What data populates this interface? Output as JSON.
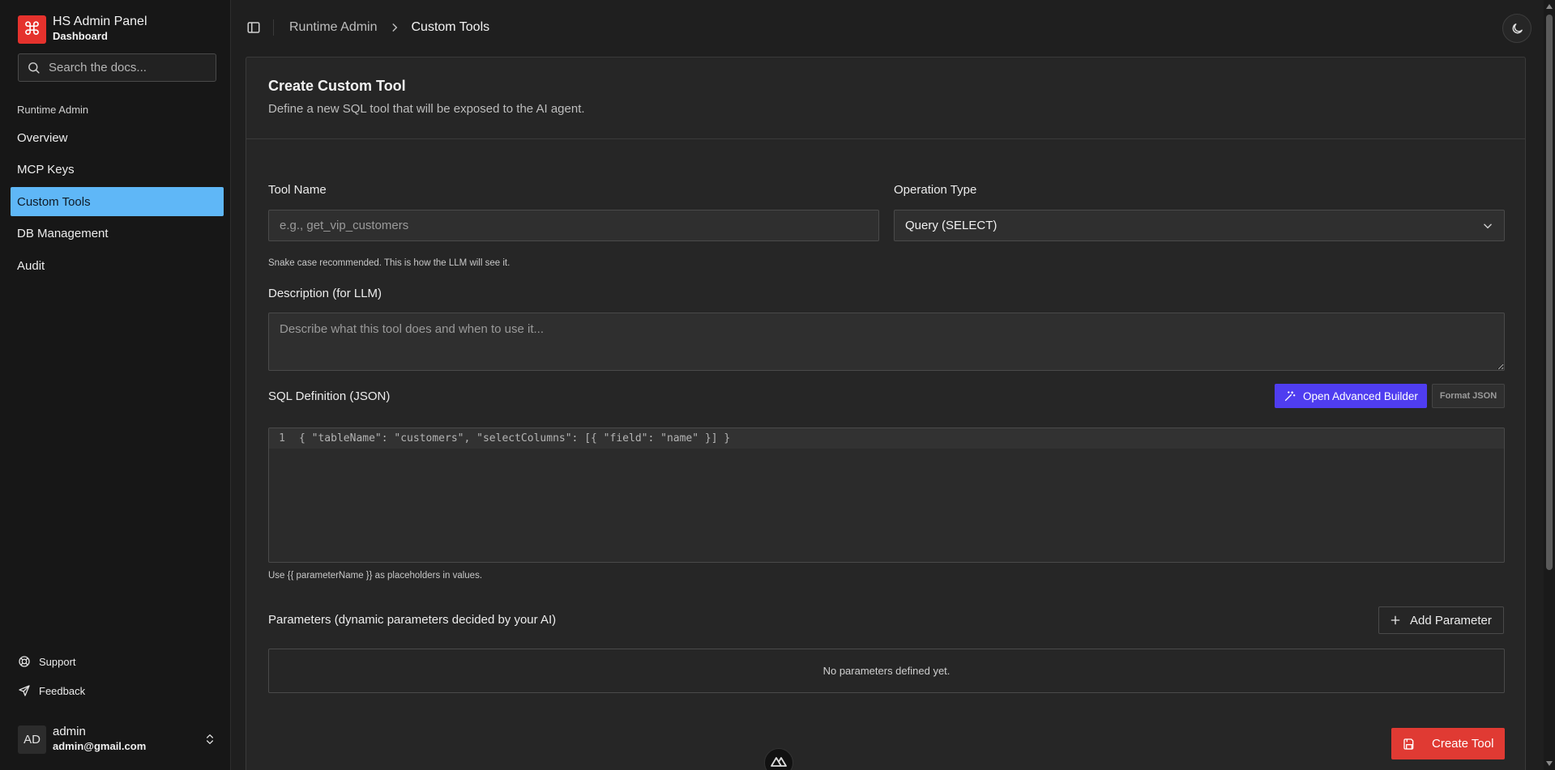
{
  "sidebar": {
    "brand": {
      "logo_glyph": "⌘",
      "title": "HS Admin Panel",
      "subtitle": "Dashboard",
      "logo_color": "#e5322d"
    },
    "search": {
      "placeholder": "Search the docs..."
    },
    "section_label": "Runtime Admin",
    "items": [
      {
        "label": "Overview",
        "active": false
      },
      {
        "label": "MCP Keys",
        "active": false
      },
      {
        "label": "Custom Tools",
        "active": true
      },
      {
        "label": "DB Management",
        "active": false
      },
      {
        "label": "Audit",
        "active": false
      }
    ],
    "footer": {
      "support": "Support",
      "feedback": "Feedback"
    },
    "user": {
      "initials": "AD",
      "name": "admin",
      "email": "admin@gmail.com"
    }
  },
  "header": {
    "breadcrumb": {
      "parent": "Runtime Admin",
      "current": "Custom Tools"
    }
  },
  "form": {
    "title": "Create Custom Tool",
    "description": "Define a new SQL tool that will be exposed to the AI agent.",
    "tool_name": {
      "label": "Tool Name",
      "placeholder": "e.g., get_vip_customers",
      "hint": "Snake case recommended. This is how the LLM will see it."
    },
    "operation_type": {
      "label": "Operation Type",
      "value": "Query (SELECT)"
    },
    "llm_description": {
      "label": "Description (for LLM)",
      "placeholder": "Describe what this tool does and when to use it..."
    },
    "sql_definition": {
      "label": "SQL Definition (JSON)",
      "advanced_builder_label": "Open Advanced Builder",
      "format_json_label": "Format JSON",
      "line_number": "1",
      "code": "{ \"tableName\": \"customers\", \"selectColumns\": [{ \"field\": \"name\" }] }",
      "hint": "Use {{ parameterName }} as placeholders in values."
    },
    "parameters": {
      "label": "Parameters (dynamic parameters decided by your AI)",
      "add_label": "Add Parameter",
      "empty_text": "No parameters defined yet."
    },
    "submit_label": "Create Tool"
  },
  "colors": {
    "active_nav": "#5fb7f7",
    "primary_button": "#4f3df0",
    "danger_button": "#e03a33"
  }
}
